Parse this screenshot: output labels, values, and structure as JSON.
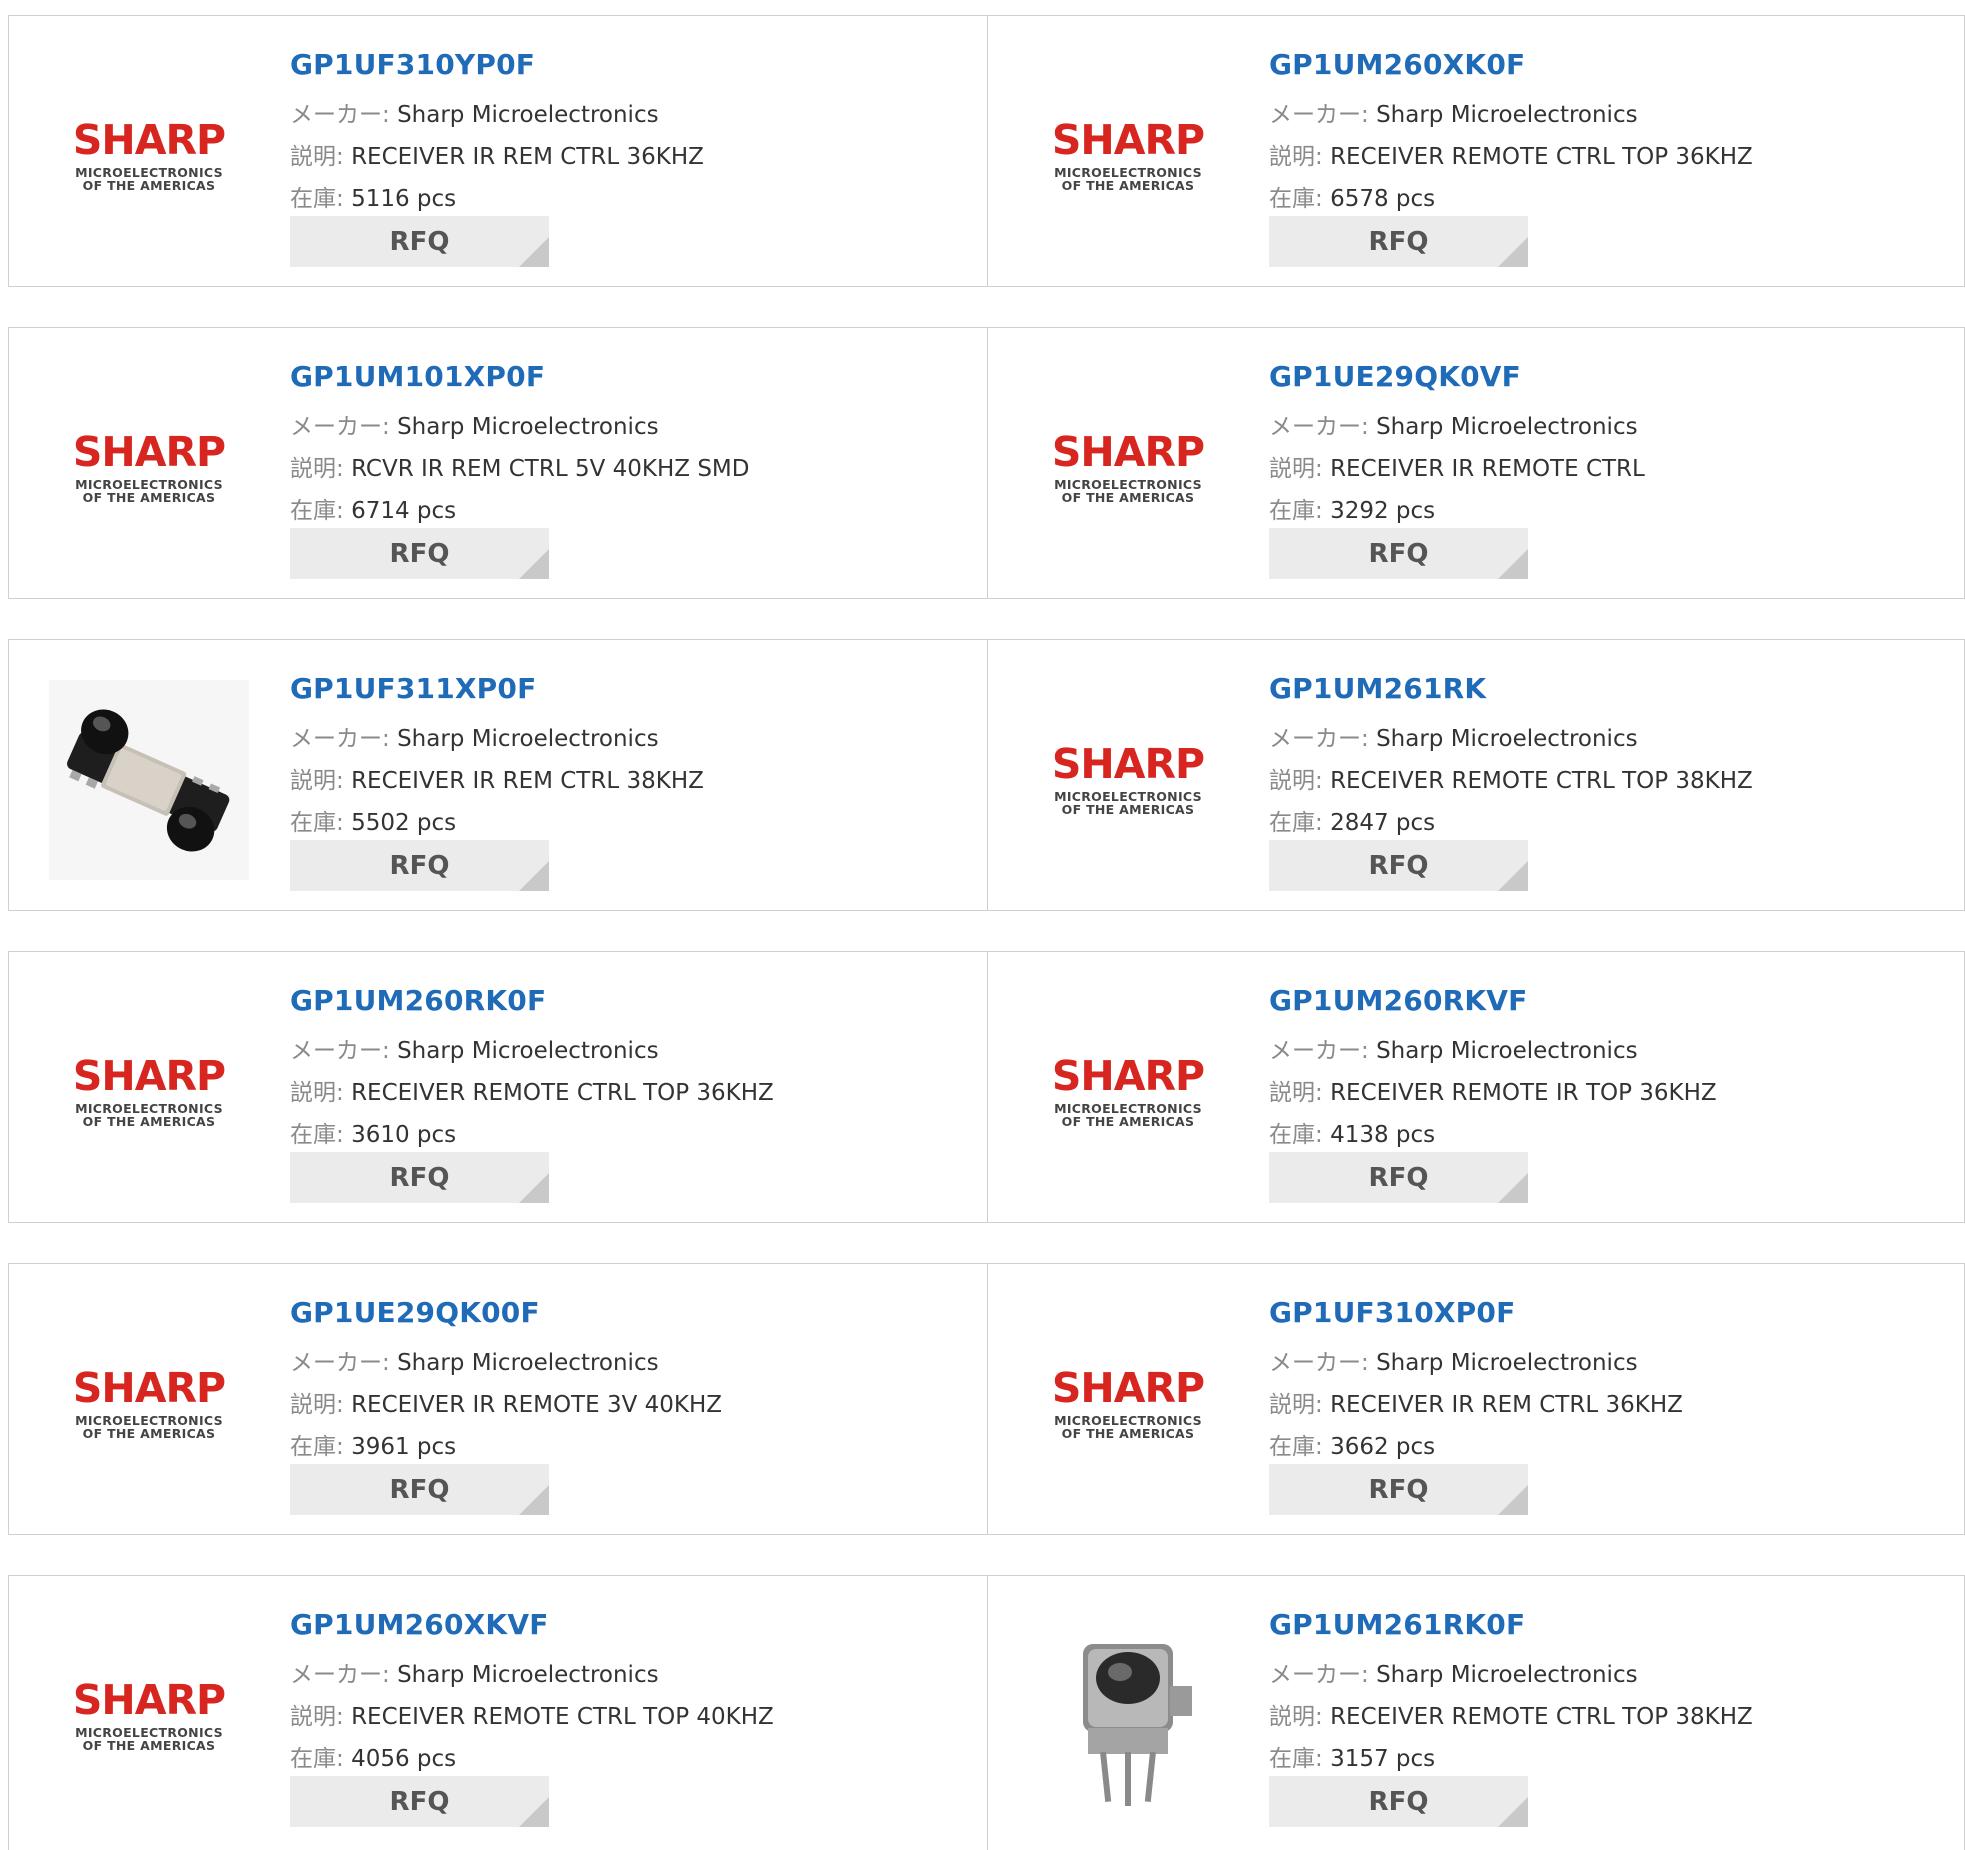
{
  "labels": {
    "maker": "メーカー:",
    "desc": "説明:",
    "stock": "在庫:",
    "rfq": "RFQ"
  },
  "logo": {
    "word": "SHARP",
    "sub1": "MICROELECTRONICS",
    "sub2": "OF THE AMERICAS"
  },
  "products": [
    {
      "part": "GP1UF310YP0F",
      "maker": "Sharp Microelectronics",
      "desc": "RECEIVER IR REM CTRL 36KHZ",
      "stock": "5116 pcs",
      "image": "sharp-logo"
    },
    {
      "part": "GP1UM260XK0F",
      "maker": "Sharp Microelectronics",
      "desc": "RECEIVER REMOTE CTRL TOP 36KHZ",
      "stock": "6578 pcs",
      "image": "sharp-logo"
    },
    {
      "part": "GP1UM101XP0F",
      "maker": "Sharp Microelectronics",
      "desc": "RCVR IR REM CTRL 5V 40KHZ SMD",
      "stock": "6714 pcs",
      "image": "sharp-logo"
    },
    {
      "part": "GP1UE29QK0VF",
      "maker": "Sharp Microelectronics",
      "desc": "RECEIVER IR REMOTE CTRL",
      "stock": "3292 pcs",
      "image": "sharp-logo"
    },
    {
      "part": "GP1UF311XP0F",
      "maker": "Sharp Microelectronics",
      "desc": "RECEIVER IR REM CTRL 38KHZ",
      "stock": "5502 pcs",
      "image": "smd-ir-receiver-photo"
    },
    {
      "part": "GP1UM261RK",
      "maker": "Sharp Microelectronics",
      "desc": "RECEIVER REMOTE CTRL TOP 38KHZ",
      "stock": "2847 pcs",
      "image": "sharp-logo"
    },
    {
      "part": "GP1UM260RK0F",
      "maker": "Sharp Microelectronics",
      "desc": "RECEIVER REMOTE CTRL TOP 36KHZ",
      "stock": "3610 pcs",
      "image": "sharp-logo"
    },
    {
      "part": "GP1UM260RKVF",
      "maker": "Sharp Microelectronics",
      "desc": "RECEIVER REMOTE IR TOP 36KHZ",
      "stock": "4138 pcs",
      "image": "sharp-logo"
    },
    {
      "part": "GP1UE29QK00F",
      "maker": "Sharp Microelectronics",
      "desc": "RECEIVER IR REMOTE 3V 40KHZ",
      "stock": "3961 pcs",
      "image": "sharp-logo"
    },
    {
      "part": "GP1UF310XP0F",
      "maker": "Sharp Microelectronics",
      "desc": "RECEIVER IR REM CTRL 36KHZ",
      "stock": "3662 pcs",
      "image": "sharp-logo"
    },
    {
      "part": "GP1UM260XKVF",
      "maker": "Sharp Microelectronics",
      "desc": "RECEIVER REMOTE CTRL TOP 40KHZ",
      "stock": "4056 pcs",
      "image": "sharp-logo"
    },
    {
      "part": "GP1UM261RK0F",
      "maker": "Sharp Microelectronics",
      "desc": "RECEIVER REMOTE CTRL TOP 38KHZ",
      "stock": "3157 pcs",
      "image": "through-hole-ir-receiver-photo"
    }
  ],
  "colors": {
    "part_link": "#1f6bb8",
    "brand_red": "#d7261f",
    "border": "#cfcfcf",
    "button_bg": "#ebebeb"
  }
}
